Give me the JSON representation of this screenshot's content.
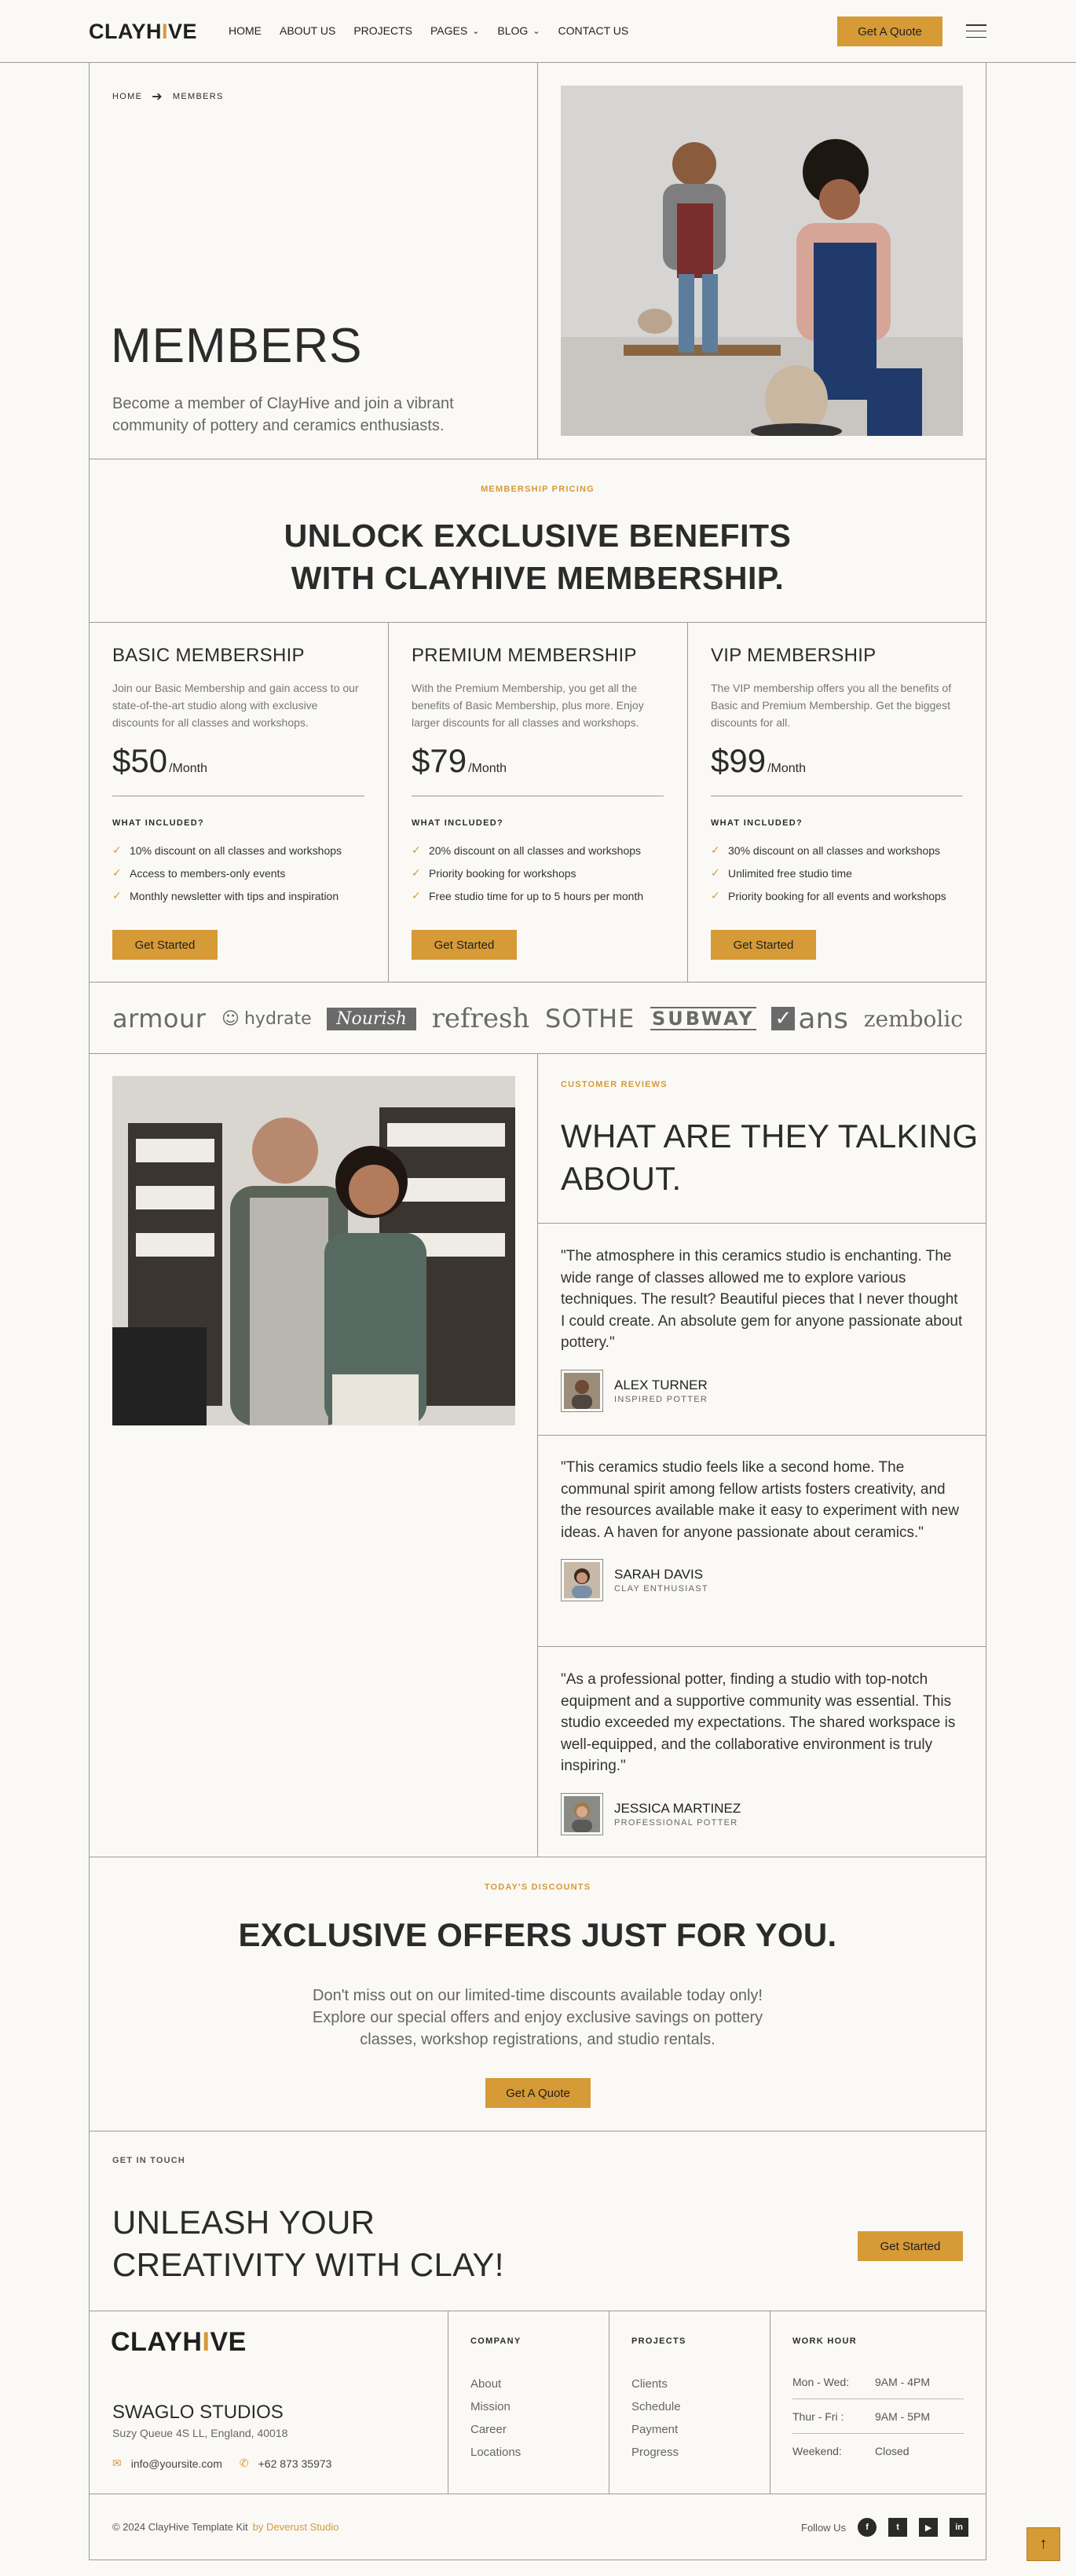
{
  "header": {
    "logo_main": "CLAYH",
    "logo_accent": "I",
    "logo_end": "VE",
    "nav": [
      {
        "label": "HOME",
        "dropdown": false
      },
      {
        "label": "ABOUT US",
        "dropdown": false
      },
      {
        "label": "PROJECTS",
        "dropdown": false
      },
      {
        "label": "PAGES",
        "dropdown": true
      },
      {
        "label": "BLOG",
        "dropdown": true
      },
      {
        "label": "CONTACT US",
        "dropdown": false
      }
    ],
    "cta": "Get A Quote",
    "menu_icon": "hamburger-icon"
  },
  "hero": {
    "breadcrumb": [
      "HOME",
      "MEMBERS"
    ],
    "title": "MEMBERS",
    "subtitle": "Become a member of ClayHive and join a vibrant community of pottery and ceramics enthusiasts."
  },
  "pricing": {
    "kicker": "MEMBERSHIP PRICING",
    "title_line1": "UNLOCK EXCLUSIVE BENEFITS",
    "title_line2": "WITH CLAYHIVE MEMBERSHIP.",
    "plans": [
      {
        "name": "BASIC MEMBERSHIP",
        "desc": "Join our Basic Membership and gain access to our state-of-the-art studio along with exclusive discounts for all classes and workshops.",
        "price": "$50",
        "period": "/Month",
        "included_label": "WHAT INCLUDED?",
        "features": [
          "10% discount on all classes and workshops",
          "Access to members-only events",
          "Monthly newsletter with tips and inspiration"
        ],
        "cta": "Get Started"
      },
      {
        "name": "PREMIUM MEMBERSHIP",
        "desc": "With the Premium Membership, you get all the benefits of Basic Membership, plus more. Enjoy larger discounts for all classes and workshops.",
        "price": "$79",
        "period": "/Month",
        "included_label": "WHAT INCLUDED?",
        "features": [
          "20% discount on all classes and workshops",
          "Priority booking for workshops",
          "Free studio time for up to 5 hours per month"
        ],
        "cta": "Get Started"
      },
      {
        "name": "VIP MEMBERSHIP",
        "desc": "The VIP membership offers you all the benefits of Basic and Premium Membership. Get the biggest discounts for all.",
        "price": "$99",
        "period": "/Month",
        "included_label": "WHAT INCLUDED?",
        "features": [
          "30% discount on all classes and workshops",
          "Unlimited free studio time",
          "Priority booking for all events and workshops"
        ],
        "cta": "Get Started"
      }
    ]
  },
  "brands": [
    "armour",
    "hydrate",
    "Nourish",
    "refresh",
    "SOTHE",
    "SUBWAY",
    "ans",
    "zembolic"
  ],
  "reviews": {
    "kicker": "CUSTOMER REVIEWS",
    "title_line1": "WHAT ARE THEY TALKING",
    "title_line2": "ABOUT.",
    "items": [
      {
        "quote": "\"The atmosphere in this ceramics studio is enchanting. The wide range of classes allowed me to explore various techniques. The result? Beautiful pieces that I never thought I could create. An absolute gem for anyone passionate about pottery.\"",
        "name": "ALEX TURNER",
        "role": "INSPIRED POTTER"
      },
      {
        "quote": "\"This ceramics studio feels like a second home. The communal spirit among fellow artists fosters creativity, and the resources available make it easy to experiment with new ideas. A haven for anyone passionate about ceramics.\"",
        "name": "SARAH DAVIS",
        "role": "CLAY ENTHUSIAST"
      },
      {
        "quote": "\"As a professional potter, finding a studio with top-notch equipment and a supportive community was essential. This studio exceeded my expectations. The shared workspace is well-equipped, and the collaborative environment is truly inspiring.\"",
        "name": "JESSICA MARTINEZ",
        "role": "PROFESSIONAL POTTER"
      }
    ]
  },
  "offers": {
    "kicker": "TODAY'S DISCOUNTS",
    "title": "EXCLUSIVE OFFERS JUST FOR YOU.",
    "sub_line1": "Don't miss out on our limited-time discounts available today only!",
    "sub_line2": "Explore our special offers and enjoy exclusive savings on pottery",
    "sub_line3": "classes, workshop registrations, and studio rentals.",
    "cta": "Get A Quote"
  },
  "touch": {
    "kicker": "GET IN TOUCH",
    "title_line1": "UNLEASH YOUR",
    "title_line2": "CREATIVITY WITH CLAY!",
    "cta": "Get Started"
  },
  "footer": {
    "logo_main": "CLAYH",
    "logo_accent": "I",
    "logo_end": "VE",
    "studio": "SWAGLO STUDIOS",
    "address": "Suzy Queue 4S LL, England, 40018",
    "email": "info@yoursite.com",
    "phone": "+62 873 35973",
    "company": {
      "title": "COMPANY",
      "links": [
        "About",
        "Mission",
        "Career",
        "Locations"
      ]
    },
    "projects": {
      "title": "PROJECTS",
      "links": [
        "Clients",
        "Schedule",
        "Payment",
        "Progress"
      ]
    },
    "work_hour": {
      "title": "WORK HOUR",
      "rows": [
        {
          "day": "Mon - Wed:",
          "time": "9AM - 4PM"
        },
        {
          "day": "Thur - Fri :",
          "time": "9AM - 5PM"
        },
        {
          "day": "Weekend:",
          "time": "Closed"
        }
      ]
    },
    "copyright": "© 2024 ClayHive Template Kit",
    "credit": "by Deverust Studio",
    "follow": "Follow Us",
    "socials": [
      "facebook-icon",
      "twitter-icon",
      "youtube-icon",
      "linkedin-icon"
    ]
  },
  "accent_color": "#d69a36"
}
